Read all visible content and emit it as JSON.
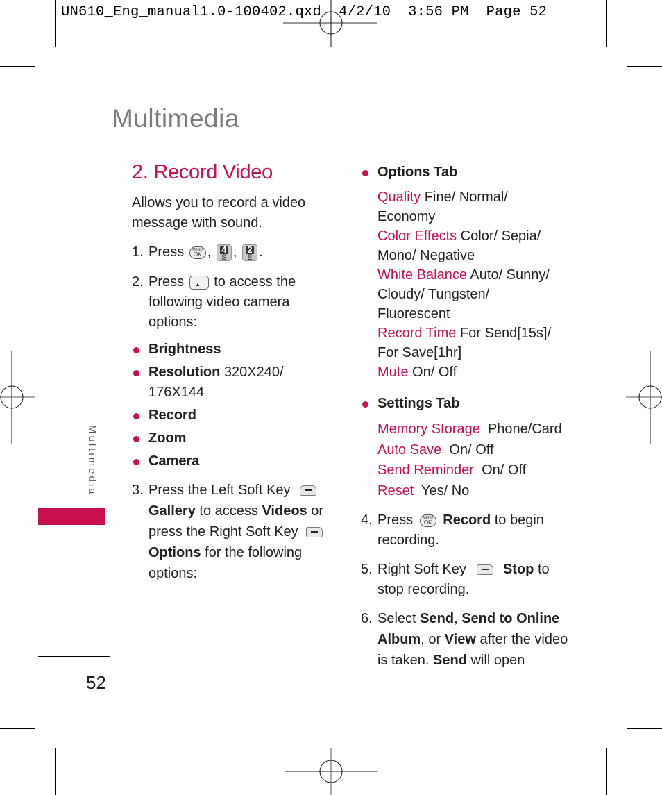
{
  "print_header": "UN610_Eng_manual1.0-100402.qxd  4/2/10  3:56 PM  Page 52",
  "page_title": "Multimedia",
  "side_tab_label": "Multimedia",
  "page_number": "52",
  "section": {
    "title": "2. Record Video",
    "intro": "Allows you to record a video message with sound.",
    "step1": {
      "num": "1.",
      "text": "Press",
      "sep1": ",",
      "sep2": ",",
      "end": ".",
      "keys": [
        "menu-ok-key",
        "key-4",
        "key-2"
      ],
      "key4": {
        "top": "4",
        "bottom": "S"
      },
      "key2": {
        "top": "2",
        "bottom": "E"
      },
      "menu_key": {
        "top": "MENU",
        "bottom": "OK"
      }
    },
    "step2": {
      "num": "2.",
      "pre": "Press",
      "post": "to access the following video camera options:"
    },
    "camera_options": [
      {
        "label": "Brightness",
        "value": ""
      },
      {
        "label": "Resolution",
        "value": " 320X240/ 176X144"
      },
      {
        "label": "Record",
        "value": ""
      },
      {
        "label": "Zoom",
        "value": ""
      },
      {
        "label": "Camera",
        "value": ""
      }
    ],
    "step3": {
      "num": "3.",
      "t1": "Press the Left Soft Key",
      "b1": "Gallery",
      "t2": " to access ",
      "b2": "Videos",
      "t3": " or press the Right Soft Key",
      "b3": "Options",
      "t4": " for the following options:"
    },
    "options_tab": {
      "title": "Options Tab",
      "items": [
        {
          "label": "Quality",
          "value": " Fine/ Normal/ Economy"
        },
        {
          "label": "Color Effects",
          "value": " Color/ Sepia/ Mono/ Negative"
        },
        {
          "label": "White Balance",
          "value": "  Auto/ Sunny/ Cloudy/ Tungsten/ Fluorescent"
        },
        {
          "label": "Record Time",
          "value": " For Send[15s]/ For Save[1hr]"
        },
        {
          "label": "Mute",
          "value": "  On/ Off"
        }
      ]
    },
    "settings_tab": {
      "title": "Settings Tab",
      "items": [
        {
          "label": "Memory Storage",
          "value": "  Phone/Card"
        },
        {
          "label": "Auto Save",
          "value": "  On/ Off"
        },
        {
          "label": "Send Reminder",
          "value": "  On/ Off"
        },
        {
          "label": "Reset",
          "value": "  Yes/ No"
        }
      ]
    },
    "step4": {
      "num": "4.",
      "pre": "Press",
      "bold": "Record",
      "post": " to begin recording."
    },
    "step5": {
      "num": "5.",
      "pre": "Right Soft Key",
      "bold": "Stop",
      "post": " to stop recording."
    },
    "step6": {
      "num": "6.",
      "t1": "Select ",
      "b1": "Send",
      "t2": ", ",
      "b2": "Send to Online Album",
      "t3": ", or ",
      "b3": "View",
      "t4": " after the video is taken. ",
      "b4": "Send",
      "t5": " will open"
    }
  },
  "colors": {
    "accent": "#c8104e",
    "title_gray": "#7a7a7a",
    "text": "#231f20"
  }
}
